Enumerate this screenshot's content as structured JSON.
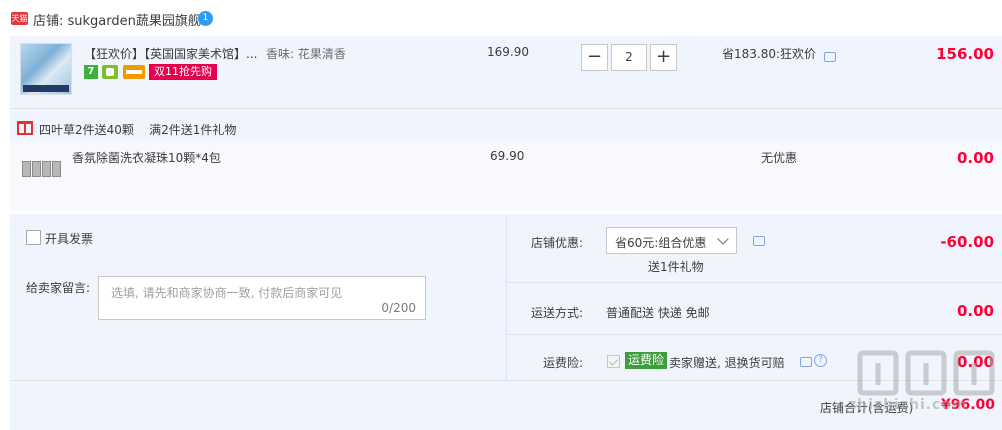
{
  "shop": {
    "badge": "天猫",
    "name": "店铺: sukgarden蔬果园旗舰",
    "ww_badge": "1"
  },
  "items": [
    {
      "title": "【狂欢价】【英国国家美术馆】...",
      "attr": "香味: 花果清香",
      "service_icons": [
        "service-7day-icon",
        "service-b-icon",
        "service-card-icon"
      ],
      "promo_tag": "双11抢先购",
      "price": "169.90",
      "quantity": "2",
      "minus": "−",
      "plus": "+",
      "saving": "省183.80:狂欢价",
      "subtotal": "156.00"
    }
  ],
  "gift": {
    "header": "四叶草2件送40颗    满2件送1件礼物",
    "title": "香氛除菌洗衣凝珠10颗*4包",
    "price": "69.90",
    "saving": "无优惠",
    "subtotal": "0.00"
  },
  "invoice": {
    "label": "开具发票",
    "checked": false
  },
  "message": {
    "label": "给卖家留言:",
    "placeholder": "选填, 请先和商家协商一致, 付款后商家可见",
    "count": "0/200"
  },
  "coupon": {
    "label": "店铺优惠:",
    "selected": "省60元:组合优惠",
    "sub": "送1件礼物",
    "amount": "-60.00"
  },
  "shipping": {
    "label": "运送方式:",
    "value": "普通配送 快递 免邮",
    "amount": "0.00"
  },
  "insurance": {
    "label": "运费险:",
    "tag": "运费险",
    "desc": "卖家赠送, 退换货可赔",
    "help": "?",
    "amount": "0.00"
  },
  "total": {
    "label": "店铺合计(含运费)",
    "amount": "¥96.00"
  },
  "watermark": "zhizhizhi.com",
  "colors": {
    "price_red": "#ff0036",
    "row_bg": "#f0f5fd",
    "promo_pink": "#e5004f",
    "insurance_green": "#3f9e3c"
  }
}
